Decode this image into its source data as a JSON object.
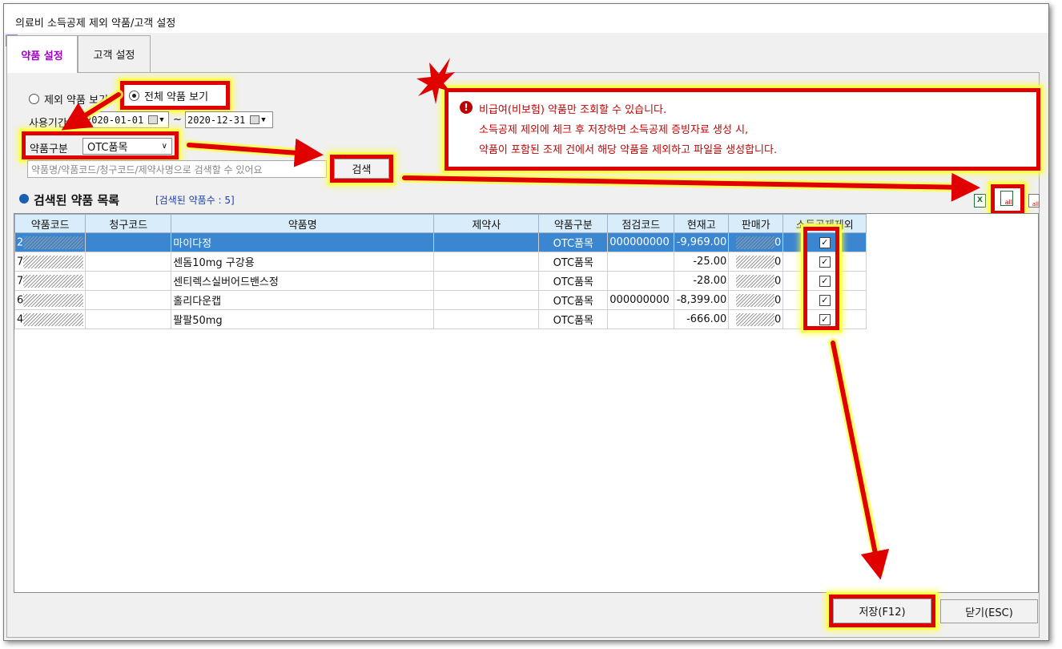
{
  "window": {
    "title": "의료비 소득공제 제외 약품/고객 설정"
  },
  "tabs": [
    {
      "label": "약품 설정",
      "active": true
    },
    {
      "label": "고객 설정",
      "active": false
    }
  ],
  "filters": {
    "radio_excluded": "제외 약품 보기",
    "radio_all": "전체 약품 보기",
    "period_label": "사용기간",
    "date_from": "2020-01-01",
    "date_sep": "~",
    "date_to": "2020-12-31",
    "category_label": "약품구분",
    "category_value": "OTC품목",
    "search_placeholder": "약품명/약품코드/청구코드/제약사명으로 검색할 수 있어요",
    "search_button": "검색"
  },
  "notice": {
    "line1": "비급여(비보험) 약품만 조회할 수 있습니다.",
    "line2": "소득공제 제외에 체크 후 저장하면 소득공제 증빙자료 생성 시,",
    "line3": "약품이 포함된 조제 건에서 해당 약품을 제외하고 파일을 생성합니다."
  },
  "list": {
    "title": "검색된 약품 목록",
    "count": "[검색된 약품수 : 5]"
  },
  "table": {
    "headers": [
      "약품코드",
      "청구코드",
      "약품명",
      "제약사",
      "약품구분",
      "점검코드",
      "현재고",
      "판매가",
      "소득공제제외"
    ],
    "rows": [
      {
        "code_prefix": "2",
        "name": "마이다정",
        "category": "OTC품목",
        "check_code": "000000000",
        "stock": "-9,969.00",
        "price_suffix": "0",
        "excluded": true
      },
      {
        "code_prefix": "7",
        "name": "센돔10mg 구강용",
        "category": "OTC품목",
        "check_code": "",
        "stock": "-25.00",
        "price_suffix": "0",
        "excluded": true
      },
      {
        "code_prefix": "7",
        "name": "센티렉스실버어드밴스정",
        "category": "OTC품목",
        "check_code": "",
        "stock": "-28.00",
        "price_suffix": "0",
        "excluded": true
      },
      {
        "code_prefix": "6",
        "name": "홀리다운캡",
        "category": "OTC품목",
        "check_code": "000000000",
        "stock": "-8,399.00",
        "price_suffix": "0",
        "excluded": true
      },
      {
        "code_prefix": "4",
        "name": "팔팔50mg",
        "category": "OTC품목",
        "check_code": "",
        "stock": "-666.00",
        "price_suffix": "0",
        "excluded": true
      }
    ]
  },
  "buttons": {
    "save": "저장(F12)",
    "close": "닫기(ESC)"
  },
  "colors": {
    "highlight": "#e00000",
    "glow": "#ffff4a",
    "selected_row": "#3b86d1",
    "header": "#d9ecf9",
    "notice_text": "#c80000"
  }
}
